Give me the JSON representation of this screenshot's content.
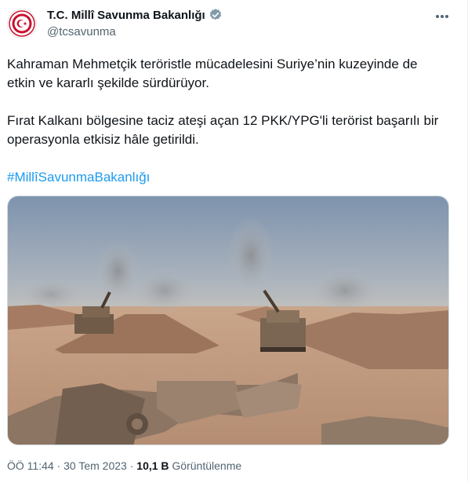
{
  "author": {
    "display_name": "T.C. Millî Savunma Bakanlığı",
    "handle": "@tcsavunma",
    "verified_icon": "verified-badge-icon",
    "avatar_icon": "ministry-seal-icon"
  },
  "menu_icon": "more-options-icon",
  "tweet": {
    "paragraph1_line1": "Kahraman Mehmetçik teröristle mücadelesini Suriye’nin kuzeyinde de",
    "paragraph1_line2": "etkin ve kararlı şekilde sürdürüyor.",
    "paragraph2_line1": "Fırat Kalkanı bölgesine taciz ateşi açan 12 PKK/YPG'li terörist başarılı bir",
    "paragraph2_line2": "operasyonla etkisiz hâle getirildi.",
    "hashtag": "#MillîSavunmaBakanlığı"
  },
  "media": {
    "description_icon": "artillery-photo"
  },
  "footer": {
    "time": "ÖÖ 11:44",
    "separator1": " · ",
    "date": "30 Tem 2023",
    "separator2": " · ",
    "views_count": "10,1 B",
    "views_label": " Görüntülenme"
  },
  "colors": {
    "link": "#1d9bf0",
    "secondary_text": "#536471",
    "verified": "#829aab",
    "seal_red": "#c8102e"
  }
}
